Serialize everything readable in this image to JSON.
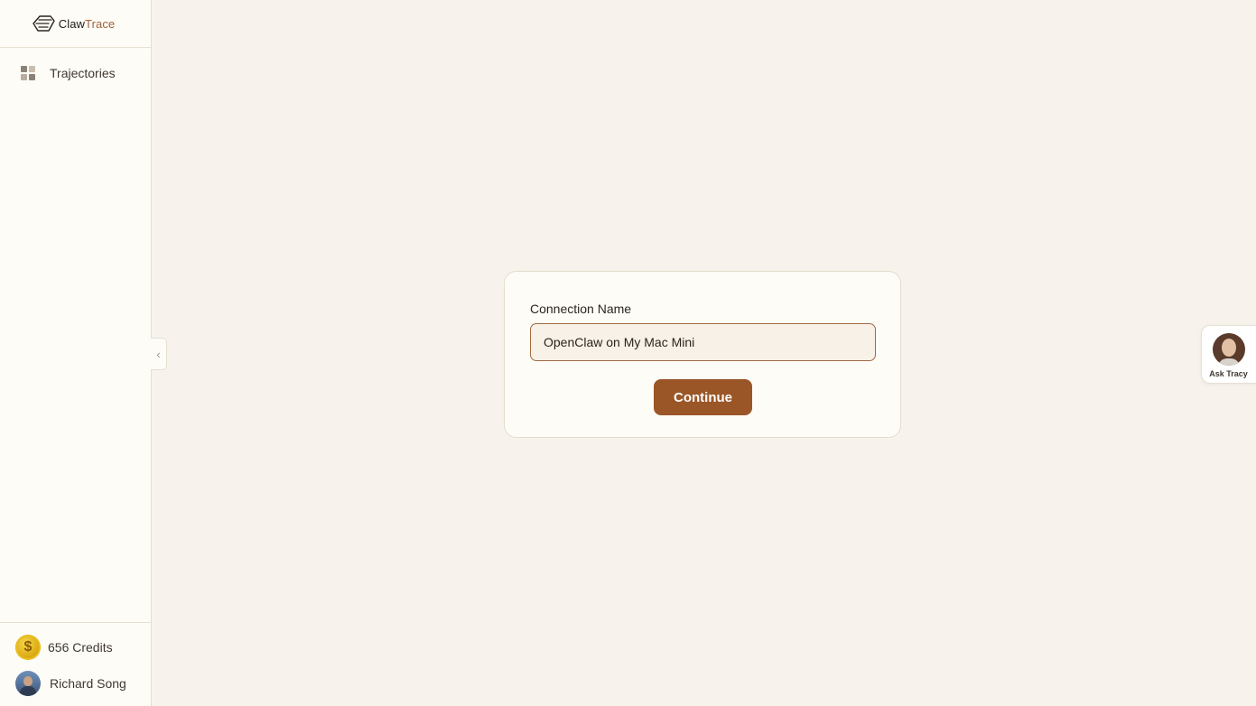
{
  "brand": {
    "name_part1": "Claw",
    "name_part2": "Trace",
    "accent": "#a0623a"
  },
  "sidebar": {
    "items": [
      {
        "label": "Trajectories",
        "icon": "grid-icon"
      }
    ],
    "credits": {
      "label": "656 Credits",
      "icon": "coin-icon"
    },
    "user": {
      "name": "Richard Song"
    },
    "collapse_icon": "chevron-left-icon"
  },
  "form": {
    "label": "Connection Name",
    "input_value": "OpenClaw on My Mac Mini",
    "submit_label": "Continue",
    "button_color": "#9a5627"
  },
  "assistant": {
    "label": "Ask Tracy"
  }
}
